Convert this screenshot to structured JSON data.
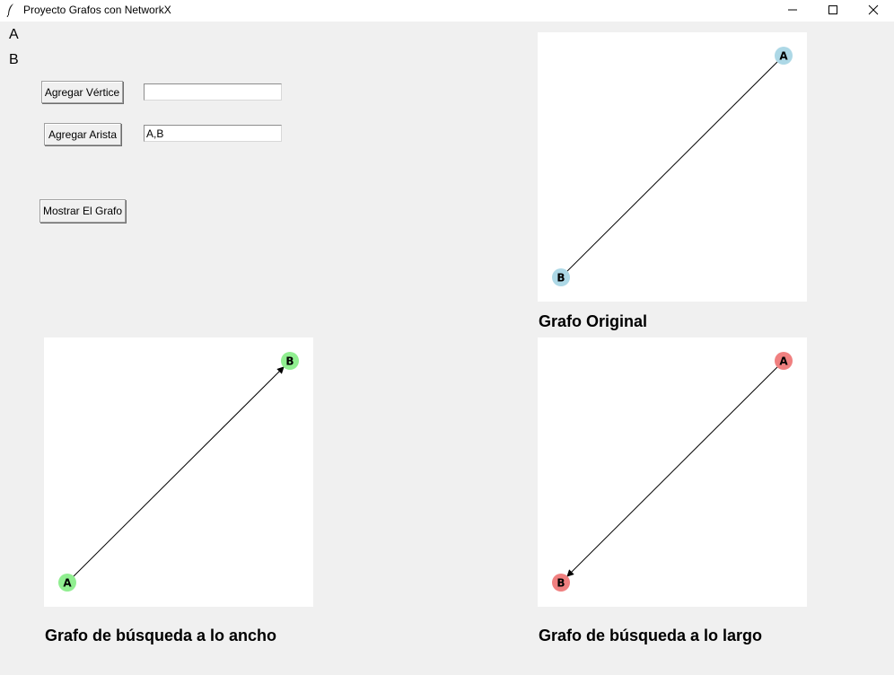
{
  "window": {
    "title": "Proyecto Grafos con NetworkX",
    "icon": "feather-icon",
    "controls": [
      "minimize-icon",
      "maximize-icon",
      "close-icon"
    ]
  },
  "vertex_list": [
    "A",
    "B"
  ],
  "controls": {
    "add_vertex_label": "Agregar Vértice",
    "add_vertex_value": "",
    "add_edge_label": "Agregar Arista",
    "add_edge_value": "A,B",
    "show_graph_label": "Mostrar El Grafo"
  },
  "graphs": {
    "original": {
      "caption": "Grafo Original",
      "node_color": "#add8e6",
      "nodes": [
        "A",
        "B"
      ],
      "edges": [
        [
          "A",
          "B"
        ]
      ],
      "directed": false
    },
    "bfs": {
      "caption": "Grafo de búsqueda a lo ancho",
      "node_color": "#90ee90",
      "nodes": [
        "B",
        "A"
      ],
      "edges": [
        [
          "A",
          "B"
        ]
      ],
      "directed": true
    },
    "dfs": {
      "caption": "Grafo de búsqueda a lo largo",
      "node_color": "#f08080",
      "nodes": [
        "A",
        "B"
      ],
      "edges": [
        [
          "A",
          "B"
        ]
      ],
      "directed": true
    }
  }
}
